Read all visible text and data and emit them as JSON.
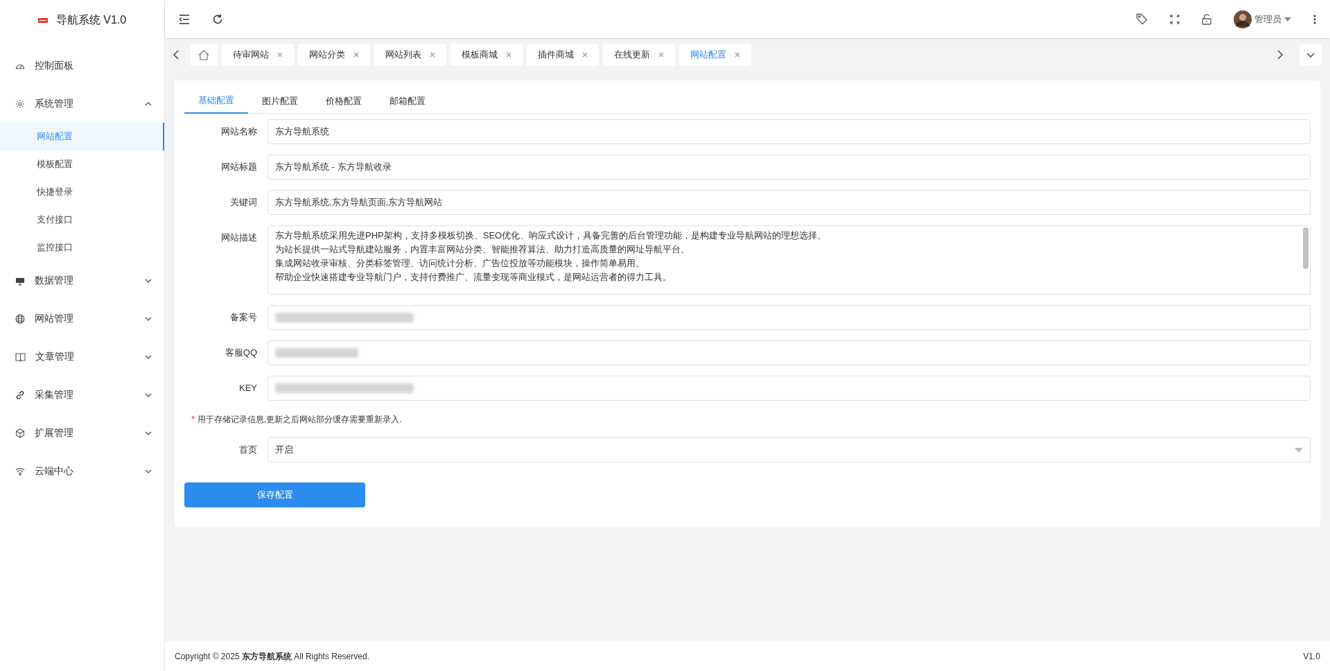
{
  "brand": {
    "title": "导航系统 V1.0"
  },
  "sidebar": {
    "items": [
      {
        "label": "控制面板"
      },
      {
        "label": "系统管理",
        "expanded": true,
        "children": [
          {
            "label": "网站配置",
            "selected": true
          },
          {
            "label": "模板配置",
            "selected": false
          },
          {
            "label": "快捷登录",
            "selected": false
          },
          {
            "label": "支付接口",
            "selected": false
          },
          {
            "label": "监控接口",
            "selected": false
          }
        ]
      },
      {
        "label": "数据管理",
        "expanded": false
      },
      {
        "label": "网站管理",
        "expanded": false
      },
      {
        "label": "文章管理",
        "expanded": false
      },
      {
        "label": "采集管理",
        "expanded": false
      },
      {
        "label": "扩展管理",
        "expanded": false
      },
      {
        "label": "云端中心",
        "expanded": false
      }
    ]
  },
  "header": {
    "user": "管理员"
  },
  "page_tabs": [
    {
      "kind": "home",
      "selected": false
    },
    {
      "label": "待审网站",
      "selected": false
    },
    {
      "label": "网站分类",
      "selected": false
    },
    {
      "label": "网站列表",
      "selected": false
    },
    {
      "label": "模板商城",
      "selected": false
    },
    {
      "label": "插件商城",
      "selected": false
    },
    {
      "label": "在线更新",
      "selected": false
    },
    {
      "label": "网站配置",
      "selected": true
    }
  ],
  "config_tabs": [
    {
      "label": "基础配置",
      "selected": true
    },
    {
      "label": "图片配置",
      "selected": false
    },
    {
      "label": "价格配置",
      "selected": false
    },
    {
      "label": "邮箱配置",
      "selected": false
    }
  ],
  "form": {
    "fields": [
      {
        "kind": "text",
        "label": "网站名称",
        "value": "东方导航系统"
      },
      {
        "kind": "text",
        "label": "网站标题",
        "value": "东方导航系统 - 东方导航收录"
      },
      {
        "kind": "text",
        "label": "关键词",
        "value": "东方导航系统,东方导航页面,东方导航网站"
      },
      {
        "kind": "textarea",
        "label": "网站描述",
        "lines": [
          "东方导航系统采用先进PHP架构，支持多模板切换、SEO优化、响应式设计，具备完善的后台管理功能，是构建专业导航网站的理想选择。",
          "为站长提供一站式导航建站服务，内置丰富网站分类、智能推荐算法、助力打造高质量的网址导航平台。",
          "集成网站收录审核、分类标签管理、访问统计分析、广告位投放等功能模块，操作简单易用。",
          "帮助企业快速搭建专业导航门户，支持付费推广、流量变现等商业模式，是网站运营者的得力工具。"
        ]
      },
      {
        "kind": "blurred",
        "label": "备案号"
      },
      {
        "kind": "blurred",
        "label": "客服QQ"
      },
      {
        "kind": "blurred",
        "label": "KEY"
      },
      {
        "kind": "hint",
        "mark": "*",
        "text": "用于存储记录信息,更新之后网站部分缓存需要重新录入."
      },
      {
        "kind": "select",
        "label": "首页",
        "value": "开启"
      }
    ],
    "submit": "保存配置"
  },
  "footer": {
    "copyright": "Copyright © 2025 **东方导航系统** All Rights Reserved.",
    "version": "V1.0"
  }
}
